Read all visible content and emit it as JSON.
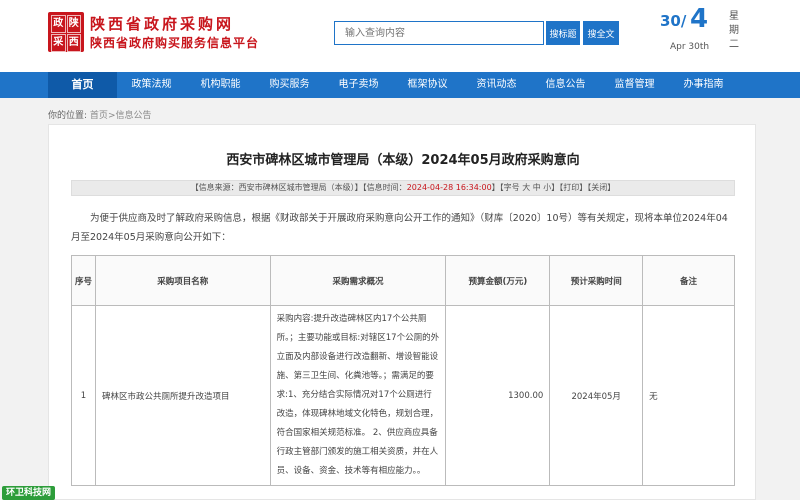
{
  "header": {
    "logo_chars": [
      "政",
      "陕",
      "采",
      "西"
    ],
    "site_name": "陕西省政府采购网",
    "site_sub": "陕西省政府购买服务信息平台",
    "search_placeholder": "输入查询内容",
    "search_button": "搜标题",
    "fulltext_button": "搜全文",
    "date_day": "30/",
    "date_month": "4",
    "date_en": "Apr 30th",
    "weekday": "星期二"
  },
  "nav": {
    "items": [
      "首页",
      "政策法规",
      "机构职能",
      "购买服务",
      "电子卖场",
      "框架协议",
      "资讯动态",
      "信息公告",
      "监督管理",
      "办事指南"
    ],
    "active_index": 0
  },
  "breadcrumb": {
    "label": "你的位置:",
    "home": "首页",
    "current": ">信息公告"
  },
  "article": {
    "title": "西安市碑林区城市管理局（本级）2024年05月政府采购意向",
    "meta_source": "【信息来源：西安市碑林区城市管理局（本级）】【信息时间：",
    "meta_time": "2024-04-28 16:34:00",
    "meta_tail": "】【字号 大 中 小】【打印】【关闭】",
    "intro": "为便于供应商及时了解政府采购信息，根据《财政部关于开展政府采购意向公开工作的通知》（财库〔2020〕10号）等有关规定，现将本单位2024年04月至2024年05月采购意向公开如下："
  },
  "table": {
    "headers": [
      "序号",
      "采购项目名称",
      "采购需求概况",
      "预算金额(万元)",
      "预计采购时间",
      "备注"
    ],
    "rows": [
      {
        "index": "1",
        "name": "碑林区市政公共厕所提升改造项目",
        "desc": "采购内容:提升改造碑林区内17个公共厕所。；主要功能或目标:对辖区17个公厕的外立面及内部设备进行改造翻新、增设智能设施、第三卫生间、化粪池等。；需满足的要求:1、充分结合实际情况对17个公厕进行改造，体现碑林地域文化特色，规划合理，符合国家相关规范标准。 2、供应商应具备行政主管部门颁发的施工相关资质，并在人员、设备、资金、技术等有相应能力。。",
        "amount": "1300.00",
        "time": "2024年05月",
        "remark": "无"
      }
    ]
  },
  "watermark": "环卫科技网"
}
